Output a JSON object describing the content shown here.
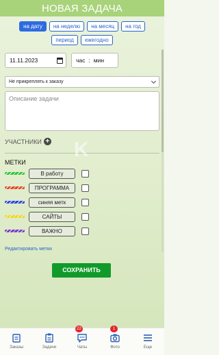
{
  "header": {
    "title": "НОВАЯ ЗАДАЧА"
  },
  "period_buttons": [
    {
      "label": "на дату",
      "active": true
    },
    {
      "label": "на неделю",
      "active": false
    },
    {
      "label": "на месяц",
      "active": false
    },
    {
      "label": "на год",
      "active": false
    },
    {
      "label": "период",
      "active": false
    },
    {
      "label": "ежегодно",
      "active": false
    }
  ],
  "date_field": {
    "value": "11.11.2023",
    "icon": "calendar-icon"
  },
  "time_field": {
    "hour_placeholder": "час",
    "separator": ":",
    "minute_placeholder": "мин"
  },
  "order_select": {
    "value": "Не прикреплять к заказу"
  },
  "description": {
    "placeholder": "Описание задачи"
  },
  "participants": {
    "label": "УЧАСТНИКИ",
    "icon": "plus-circle-icon"
  },
  "watermark": {
    "text": "K"
  },
  "tags": {
    "heading": "МЕТКИ",
    "items": [
      {
        "label": "В работу",
        "color": "#2fc43a",
        "checked": false
      },
      {
        "label": "ПРОГРАММА",
        "color": "#e5472b",
        "checked": false
      },
      {
        "label": "синяя метк",
        "color": "#2a47e0",
        "checked": false
      },
      {
        "label": "САЙТЫ",
        "color": "#f2d51c",
        "checked": false
      },
      {
        "label": "ВАЖНО",
        "color": "#7a3cc8",
        "checked": false
      }
    ],
    "edit_link": "Редактировать метки"
  },
  "save_button": {
    "label": "СОХРАНИТЬ",
    "color": "#119a2a"
  },
  "bottom_nav": [
    {
      "label": "Заказы",
      "icon": "orders-icon",
      "badge": ""
    },
    {
      "label": "Задачи",
      "icon": "tasks-icon",
      "badge": "22"
    },
    {
      "label": "Чаты",
      "icon": "chat-icon",
      "badge": "1"
    },
    {
      "label": "Фото",
      "icon": "camera-icon",
      "badge": ""
    },
    {
      "label": "Еще",
      "icon": "menu-icon",
      "badge": ""
    }
  ],
  "colors": {
    "accent": "#2e6be0",
    "header": "#a8d37a",
    "nav_icon": "#2a5fb8"
  }
}
